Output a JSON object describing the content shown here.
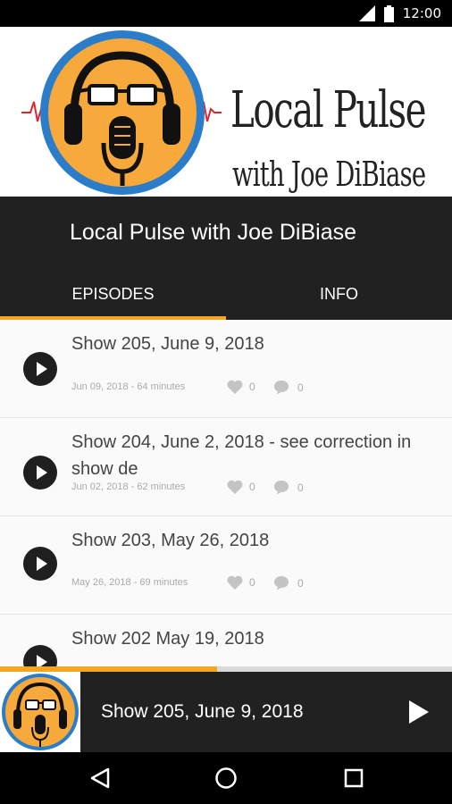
{
  "status_bar": {
    "time": "12:00",
    "icons": [
      "signal-icon",
      "battery-icon"
    ]
  },
  "banner": {
    "logo_line1": "Local Pulse",
    "logo_line2": "with Joe DiBiase"
  },
  "header": {
    "title": "Local Pulse with Joe DiBiase",
    "tabs": [
      {
        "label": "EPISODES",
        "active": true
      },
      {
        "label": "INFO",
        "active": false
      }
    ]
  },
  "episodes": [
    {
      "title": "Show 205, June 9, 2018",
      "meta": "Jun 09, 2018 - 64 minutes",
      "likes": "0",
      "comments": "0"
    },
    {
      "title": "Show 204, June 2, 2018 - see correction in show de",
      "meta": "Jun 02, 2018 - 62 minutes",
      "likes": "0",
      "comments": "0"
    },
    {
      "title": "Show 203, May 26, 2018",
      "meta": "May 26, 2018 - 69 minutes",
      "likes": "0",
      "comments": "0"
    },
    {
      "title": "Show 202 May 19, 2018",
      "meta": "",
      "likes": "",
      "comments": ""
    }
  ],
  "player": {
    "now_playing": "Show 205, June 9, 2018",
    "progress": 0.48
  },
  "colors": {
    "accent": "#f5a623",
    "dark": "#212121",
    "logo_ring": "#2b7dc9"
  },
  "nav": [
    "back-icon",
    "home-icon",
    "recents-icon"
  ]
}
